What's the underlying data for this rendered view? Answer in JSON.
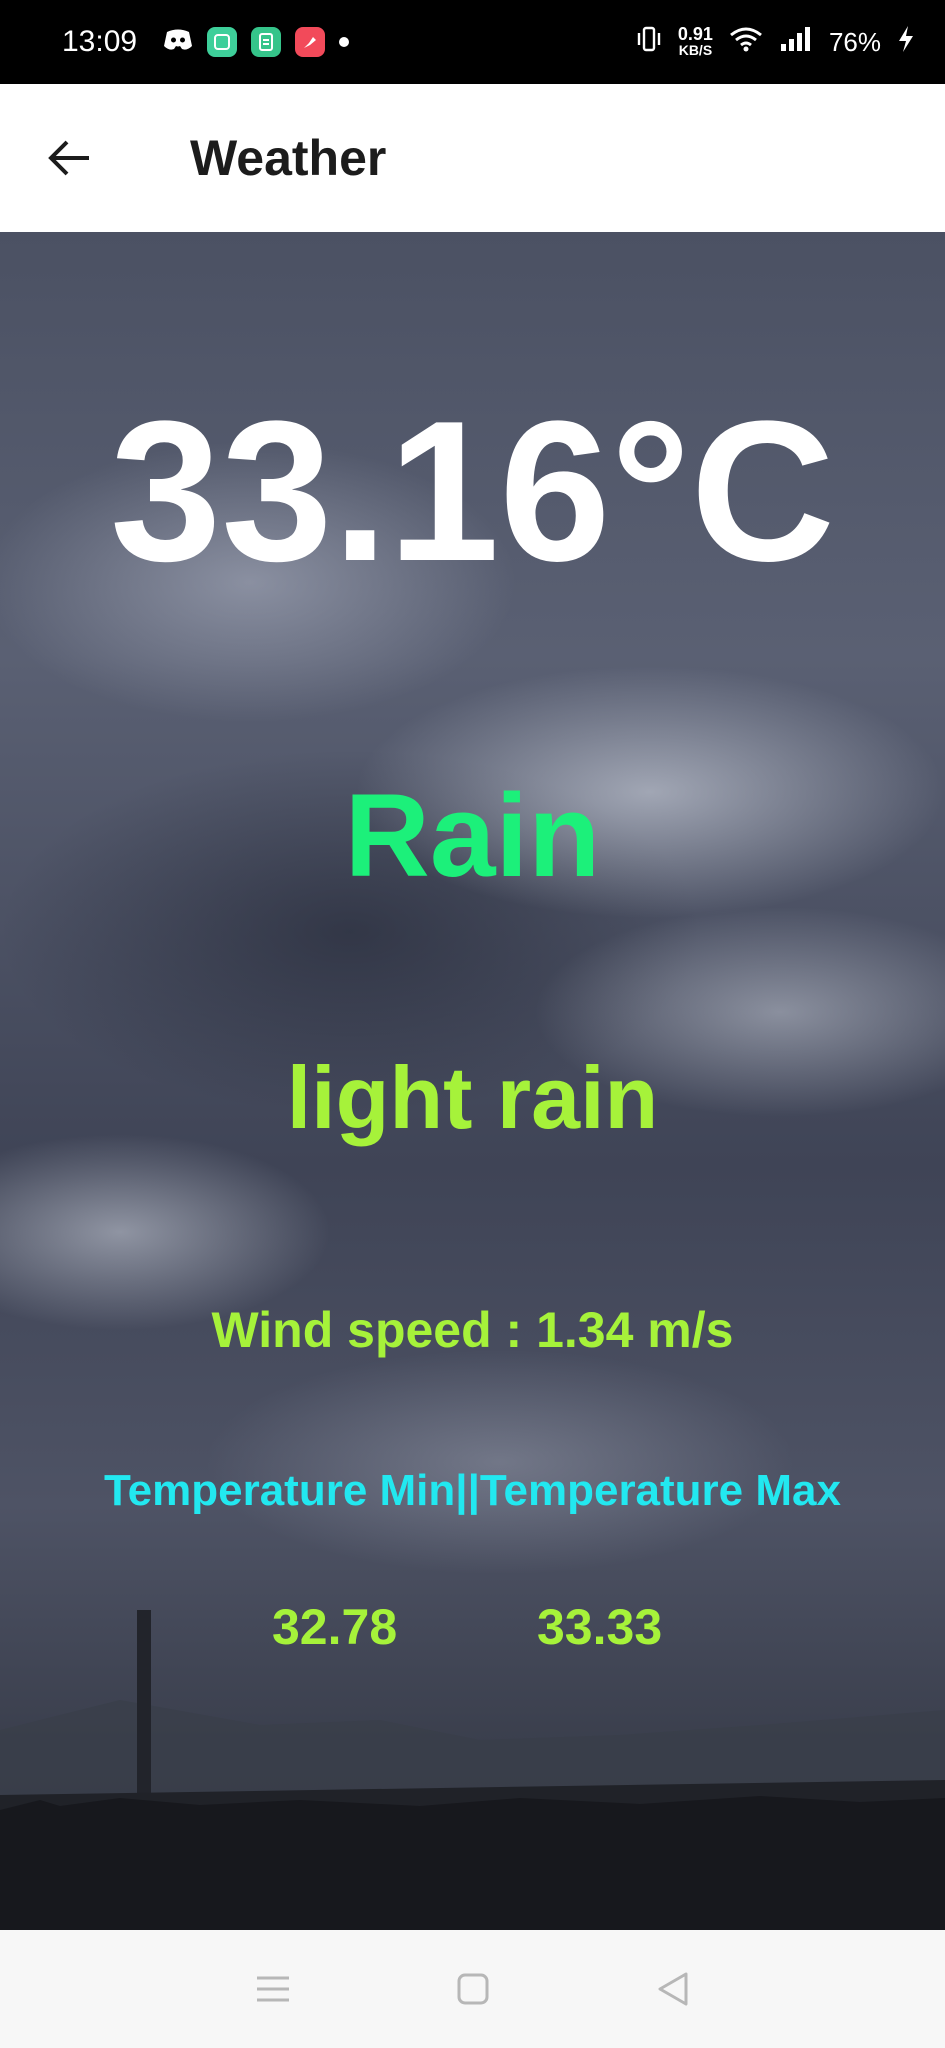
{
  "status_bar": {
    "time": "13:09",
    "net_speed_value": "0.91",
    "net_speed_unit": "KB/S",
    "battery": "76%",
    "icons": [
      "discord-icon",
      "green-app-icon",
      "green-app2-icon",
      "red-app-icon",
      "vibrate-icon",
      "wifi-icon",
      "signal-icon",
      "charging-icon"
    ]
  },
  "app_bar": {
    "title": "Weather"
  },
  "weather": {
    "temperature": "33.16°C",
    "main": "Rain",
    "description": "light rain",
    "wind": "Wind speed : 1.34 m/s",
    "minmax_label": "Temperature Min||Temperature Max",
    "temp_min": "32.78",
    "temp_max": "33.33"
  },
  "colors": {
    "temperature": "#ffffff",
    "main": "#1cf07a",
    "description": "#a6f23a",
    "minmax_label": "#22e8f0"
  }
}
